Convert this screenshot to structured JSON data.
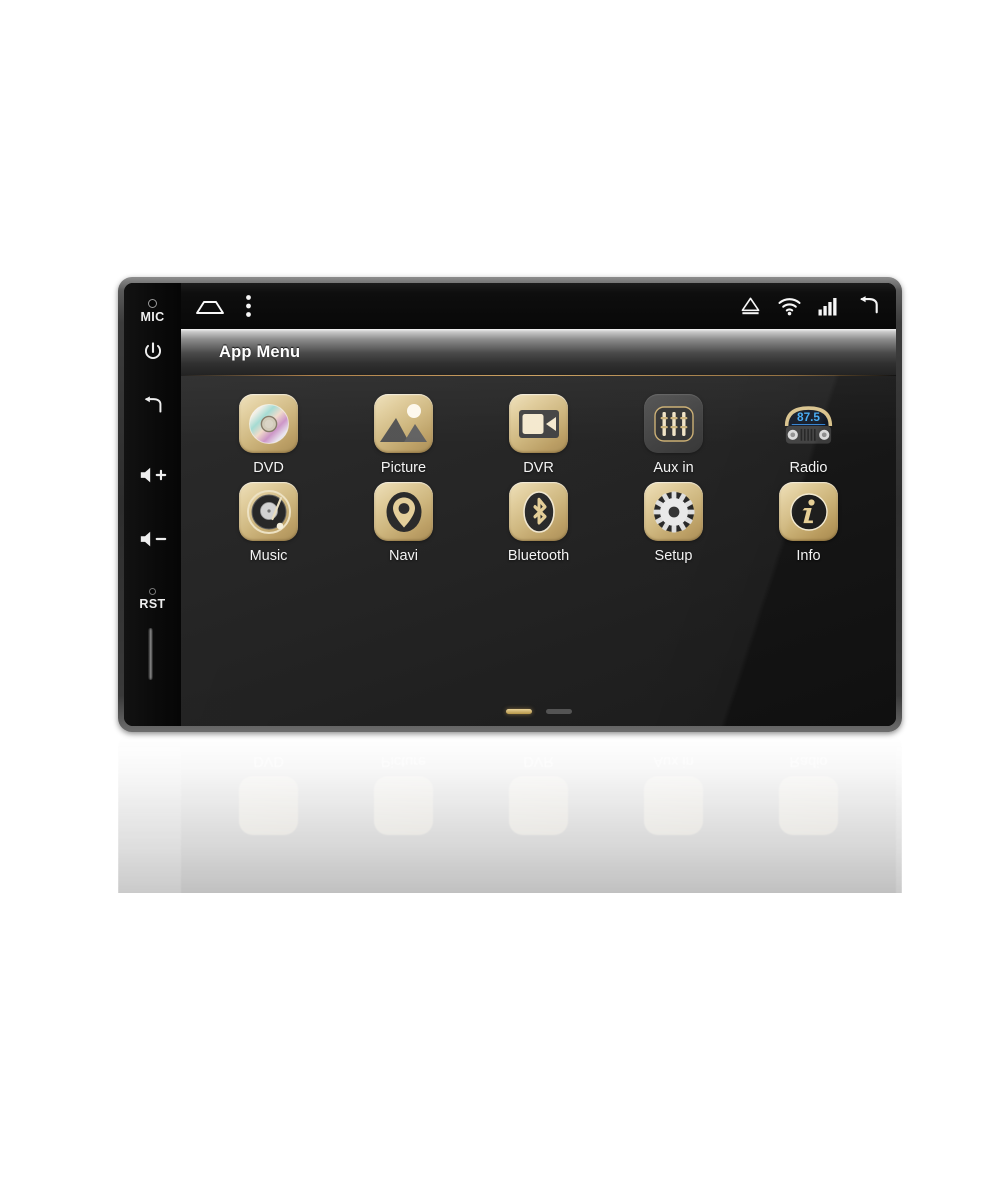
{
  "device": {
    "type": "double-din-car-stereo-head-unit",
    "bezel_buttons": [
      {
        "name": "mic",
        "label": "MIC",
        "icon": "microphone-hole-icon"
      },
      {
        "name": "power",
        "label": "",
        "icon": "power-icon"
      },
      {
        "name": "back",
        "label": "",
        "icon": "back-arrow-icon"
      },
      {
        "name": "volume-up",
        "label": "",
        "icon": "volume-up-icon"
      },
      {
        "name": "volume-down",
        "label": "",
        "icon": "volume-down-icon"
      },
      {
        "name": "reset",
        "label": "RST",
        "icon": "reset-pinhole-icon"
      },
      {
        "name": "sd-card-slot",
        "label": "",
        "icon": "sd-card-slot-icon"
      }
    ]
  },
  "statusbar": {
    "left_icons": [
      {
        "name": "home-icon",
        "glyph": "home"
      },
      {
        "name": "overflow-menu-icon",
        "glyph": "three-dots-vertical"
      }
    ],
    "right_icons": [
      {
        "name": "eject-icon",
        "glyph": "eject-triangle"
      },
      {
        "name": "wifi-icon",
        "glyph": "wifi"
      },
      {
        "name": "signal-icon",
        "glyph": "signal-bars"
      },
      {
        "name": "back-icon",
        "glyph": "back-arrow"
      }
    ]
  },
  "appbar": {
    "title": "App Menu"
  },
  "apps": [
    {
      "label": "DVD",
      "icon": "dvd-disc-icon",
      "style": "gold"
    },
    {
      "label": "Picture",
      "icon": "picture-image-icon",
      "style": "gold"
    },
    {
      "label": "DVR",
      "icon": "dvr-camcorder-icon",
      "style": "gold"
    },
    {
      "label": "Aux in",
      "icon": "aux-in-jack-icon",
      "style": "dark"
    },
    {
      "label": "Radio",
      "icon": "radio-icon",
      "style": "plain"
    },
    {
      "label": "Music",
      "icon": "music-turntable-icon",
      "style": "gold"
    },
    {
      "label": "Navi",
      "icon": "navi-pin-icon",
      "style": "gold"
    },
    {
      "label": "Bluetooth",
      "icon": "bluetooth-icon",
      "style": "gold"
    },
    {
      "label": "Setup",
      "icon": "setup-gear-icon",
      "style": "gold"
    },
    {
      "label": "Info",
      "icon": "info-icon",
      "style": "gold"
    }
  ],
  "radio_widget": {
    "frequency": "87.5"
  },
  "pager": {
    "pages": 2,
    "active_index": 0
  },
  "colors": {
    "gold_accent": "#c8a055",
    "bezel": "#2e2e2e",
    "screen_bg": "#141414",
    "radio_display_text": "#3fa9f5",
    "label_text": "#f3f3f3"
  },
  "reflection": {
    "labels": [
      "DVD",
      "Picture",
      "DVR",
      "Aux in",
      "Radio"
    ]
  }
}
